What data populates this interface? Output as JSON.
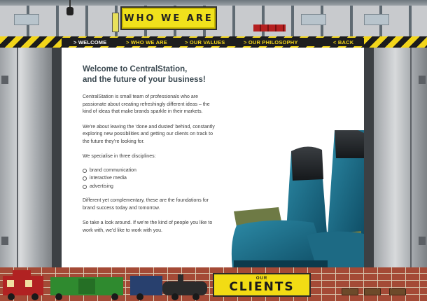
{
  "header": {
    "sign_text": "WHO WE ARE"
  },
  "nav": {
    "items": [
      {
        "label": "> WELCOME",
        "active": true
      },
      {
        "label": "> WHO WE ARE",
        "active": false
      },
      {
        "label": "> OUR VALUES",
        "active": false
      },
      {
        "label": "> OUR PHILOSOPHY",
        "active": false
      }
    ],
    "back_label": "< BACK"
  },
  "content": {
    "heading_line1": "Welcome to CentralStation,",
    "heading_line2": "and the future of your business!",
    "para1": "CentralStation is small team of professionals who are passionate about creating refreshingly different ideas – the kind of ideas that make brands sparkle in their markets.",
    "para2": "We’re about leaving the ‘done and dusted’ behind, constantly exploring new possibilities and getting our clients on track to the future they’re looking for.",
    "para3": "We specialise in three disciplines:",
    "disciplines": [
      "brand communication",
      "interactive media",
      "advertising"
    ],
    "para4": "Different yet complementary, these are the foundations for brand success today and tomorrow.",
    "para5": "So take a look around. If we’re the kind of people you like to work with, we’d like to work with you."
  },
  "footer": {
    "clients_small": "OUR",
    "clients_big": "CLIENTS"
  },
  "colors": {
    "accent": "#f2d51a",
    "nav_bg": "#1e1e1e",
    "heading": "#3c4a52",
    "seat": "#1f6f8a"
  }
}
